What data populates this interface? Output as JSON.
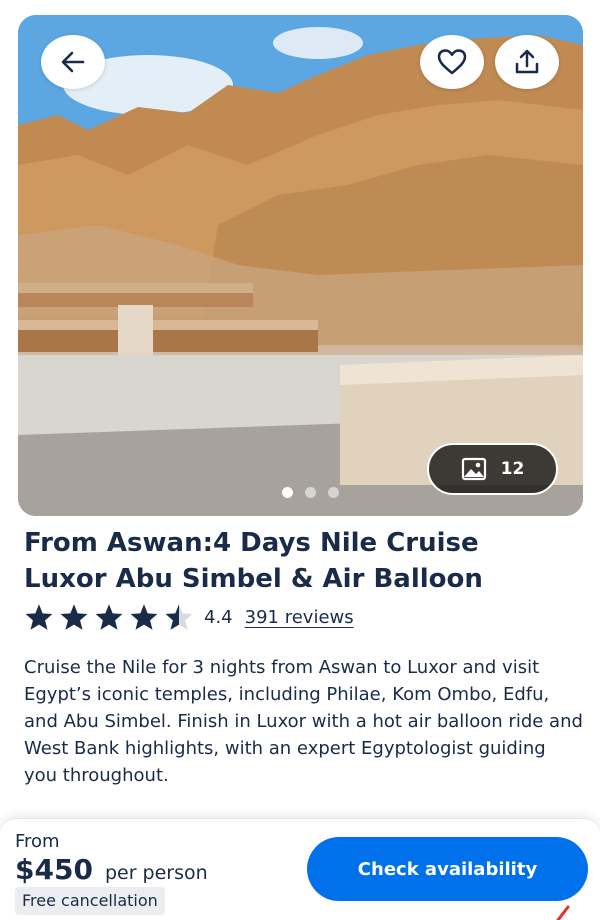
{
  "hero": {
    "image_alt": "Temple of Hatshepsut at the foot of desert cliffs",
    "gallery_count": "12",
    "slide_dots": 3,
    "active_slide": 1
  },
  "header_buttons": {
    "back_icon": "arrow-left-icon",
    "favorite_icon": "heart-icon",
    "share_icon": "share-upload-icon"
  },
  "product": {
    "title_line1": "From Aswan:4 Days Nile Cruise",
    "title_line2": "Luxor Abu Simbel & Air Balloon",
    "rating": 4.4,
    "rating_text": "4.4",
    "reviews_link": "391 reviews",
    "description": "Cruise the Nile for 3 nights from Aswan to Luxor and visit Egypt’s iconic temples, including Philae, Kom Ombo, Edfu, and Abu Simbel. Finish in Luxor with a hot air balloon ride and West Bank highlights, with an expert Egyptologist guiding you throughout."
  },
  "footer": {
    "from_label": "From",
    "price": "$450",
    "per_person": "per person",
    "cancellation_badge": "Free cancellation",
    "cta_label": "Check availability"
  },
  "colors": {
    "text_primary": "#1a2b49",
    "cta_blue": "#0071eb",
    "badge_bg": "#ecedf0"
  }
}
